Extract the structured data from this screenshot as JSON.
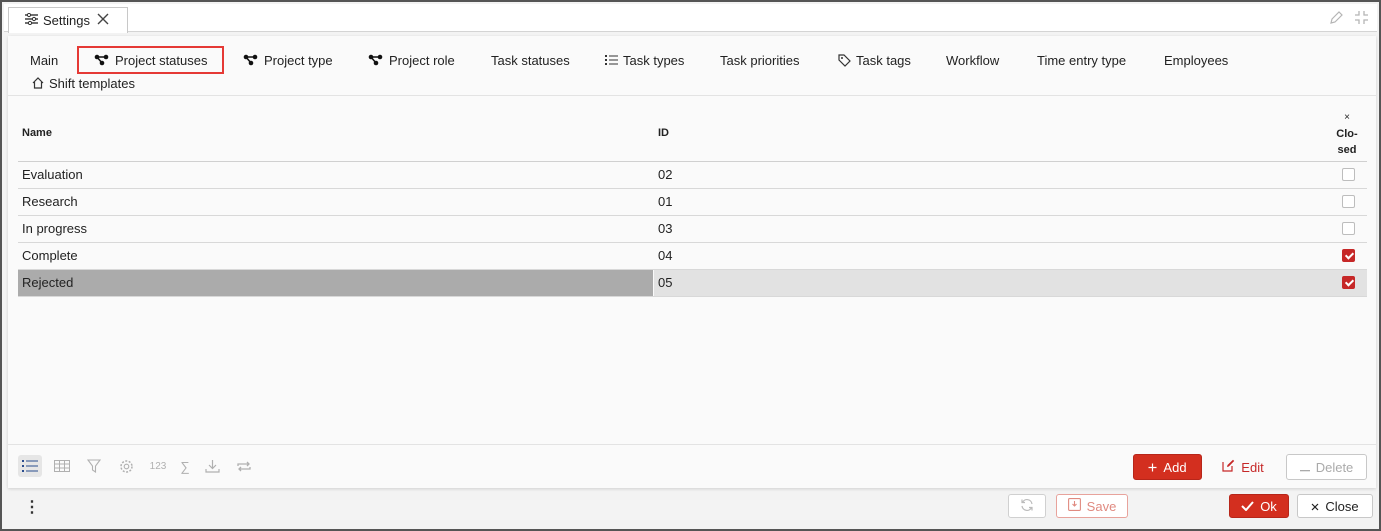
{
  "window": {
    "tab_title": "Settings",
    "tab_icon": "sliders-icon",
    "close_icon": "close-icon",
    "right_icons": [
      "pencil-icon",
      "collapse-icon"
    ]
  },
  "tabs": [
    {
      "label": "Main",
      "icon": ""
    },
    {
      "label": "Project statuses",
      "icon": "hierarchy-icon",
      "active": true
    },
    {
      "label": "Project type",
      "icon": "hierarchy-icon"
    },
    {
      "label": "Project role",
      "icon": "hierarchy-icon"
    },
    {
      "label": "Task statuses",
      "icon": ""
    },
    {
      "label": "Task types",
      "icon": "list-icon"
    },
    {
      "label": "Task priorities",
      "icon": ""
    },
    {
      "label": "Task tags",
      "icon": "tag-icon"
    },
    {
      "label": "Workflow",
      "icon": ""
    },
    {
      "label": "Time entry type",
      "icon": ""
    },
    {
      "label": "Employees",
      "icon": ""
    },
    {
      "label": "Shift templates",
      "icon": "home-icon"
    }
  ],
  "table": {
    "columns": {
      "name": "Name",
      "id": "ID",
      "closed_x": "×",
      "closed_line1": "Clo-",
      "closed_line2": "sed"
    },
    "rows": [
      {
        "name": "Evaluation",
        "id": "02",
        "closed": false
      },
      {
        "name": "Research",
        "id": "01",
        "closed": false
      },
      {
        "name": "In progress",
        "id": "03",
        "closed": false
      },
      {
        "name": "Complete",
        "id": "04",
        "closed": true
      },
      {
        "name": "Rejected",
        "id": "05",
        "closed": true,
        "selected": true
      }
    ]
  },
  "toolbar": {
    "icons": [
      "list-view-icon",
      "grid-view-icon",
      "filter-icon",
      "settings-icon",
      "numbering-icon",
      "sum-icon",
      "download-icon",
      "repeat-icon"
    ],
    "numbering_label": "123",
    "sum_label": "∑",
    "add_label": "Add",
    "edit_label": "Edit",
    "delete_label": "Delete"
  },
  "footer": {
    "kebab": "⋮",
    "save_label": "Save",
    "ok_label": "Ok",
    "close_label": "Close"
  },
  "colors": {
    "accent": "#d32f1f",
    "highlight_border": "#e53935",
    "selected_row": "#ababab"
  }
}
